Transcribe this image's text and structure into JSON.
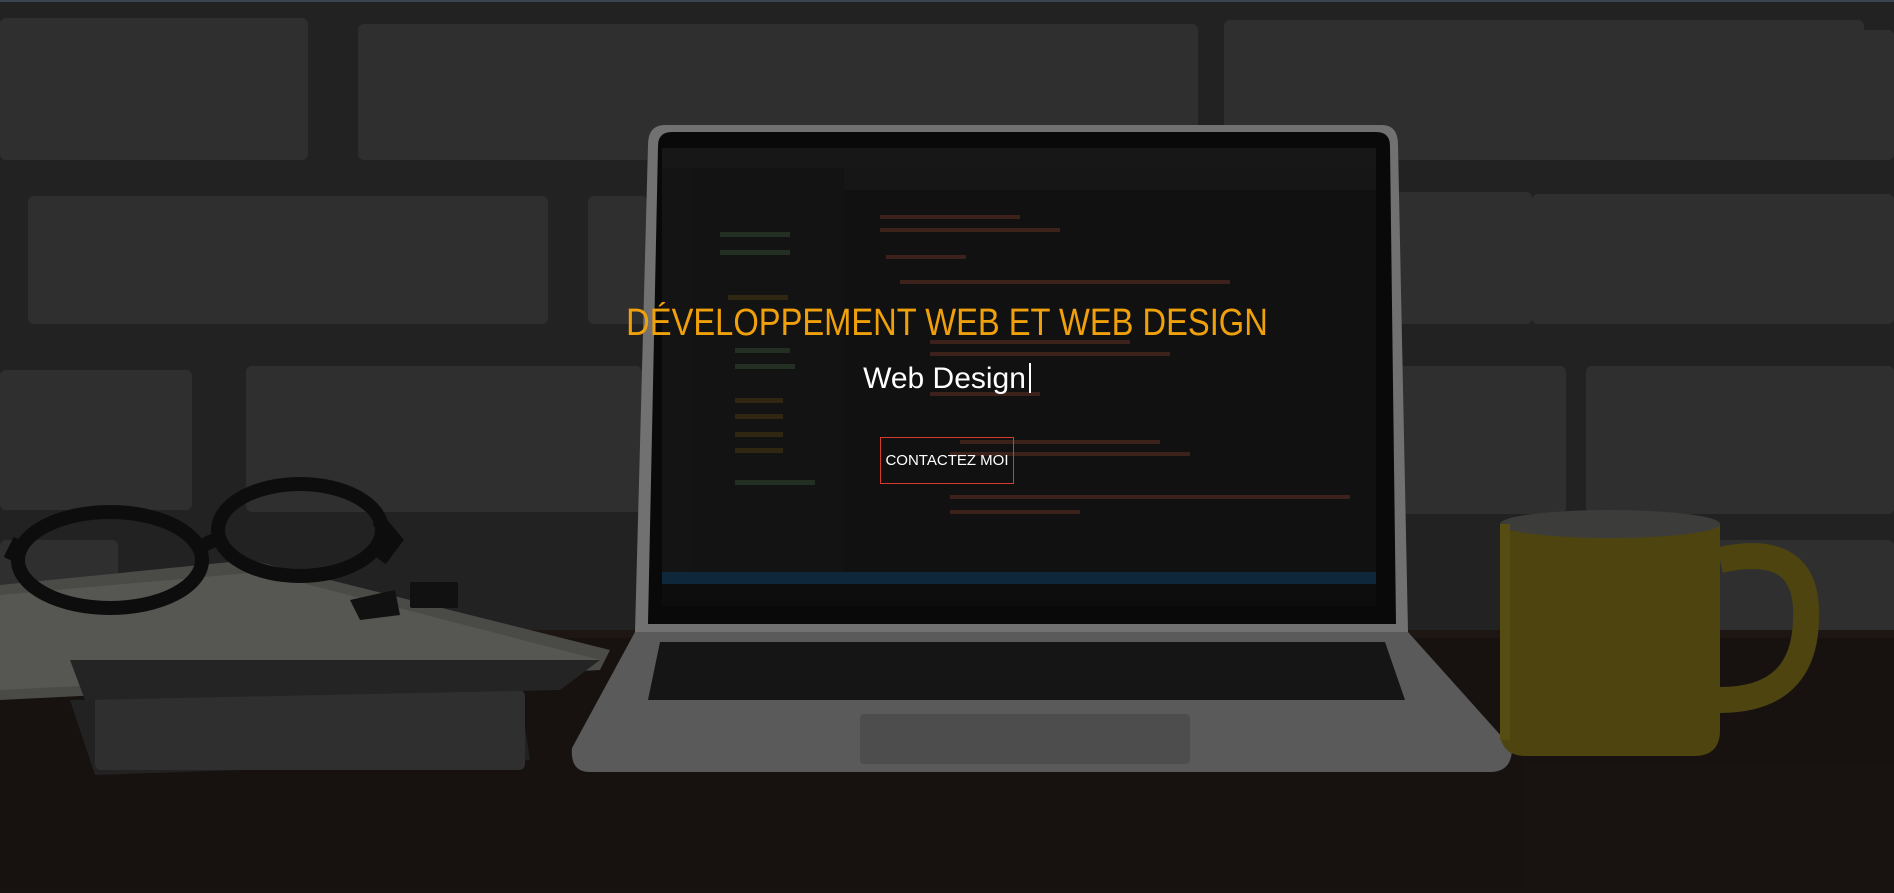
{
  "hero": {
    "title": "DÉVELOPPEMENT WEB ET WEB DESIGN",
    "typed_text": "Web Design",
    "cta_label": "CONTACTEZ MOI"
  },
  "colors": {
    "title": "#f0a00a",
    "subtitle": "#ffffff",
    "button_border": "#d63a2f",
    "background": "#141414"
  },
  "background_scene": {
    "icon_names": [
      "brick-wall",
      "laptop-with-code-editor",
      "eyeglasses",
      "notebook",
      "binder-clip",
      "yellow-mug"
    ]
  }
}
